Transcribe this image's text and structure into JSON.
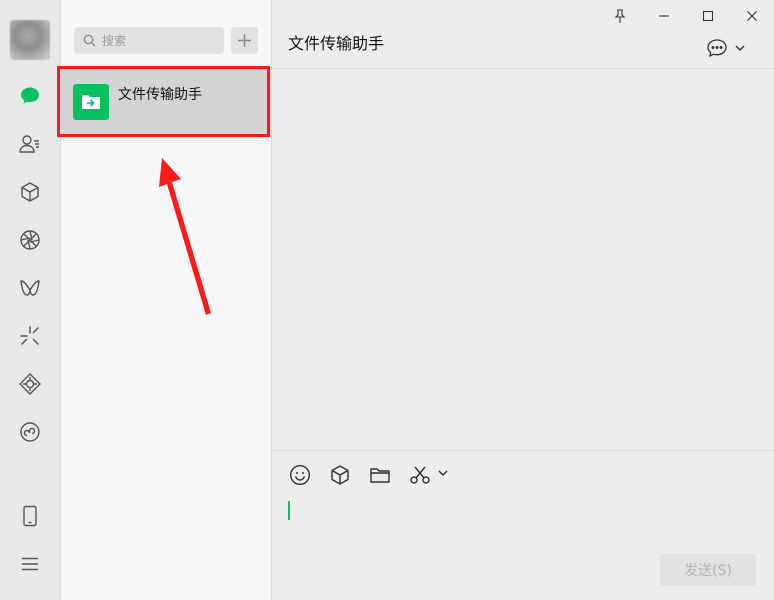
{
  "nav": {
    "items": [
      {
        "icon": "chat-icon",
        "active": true
      },
      {
        "icon": "contacts-icon"
      },
      {
        "icon": "favorites-icon"
      },
      {
        "icon": "moments-icon"
      },
      {
        "icon": "channels-icon"
      },
      {
        "icon": "discover-icon"
      },
      {
        "icon": "search-discover-icon"
      },
      {
        "icon": "mini-programs-icon"
      }
    ],
    "bottom": [
      {
        "icon": "phone-icon"
      },
      {
        "icon": "menu-icon"
      }
    ]
  },
  "search": {
    "placeholder": "搜索"
  },
  "chat_list": [
    {
      "name": "文件传输助手",
      "avatar_icon": "folder-transfer-icon",
      "selected": true
    }
  ],
  "chat": {
    "title": "文件传输助手",
    "window_controls": [
      "pin-icon",
      "minimize-icon",
      "maximize-icon",
      "close-icon"
    ],
    "toolbar": [
      "emoji-icon",
      "favorites-icon",
      "folder-icon",
      "scissors-icon"
    ],
    "input_value": "",
    "send_label": "发送(S)"
  },
  "colors": {
    "accent": "#07c160",
    "annotation": "#ff1a1a"
  }
}
